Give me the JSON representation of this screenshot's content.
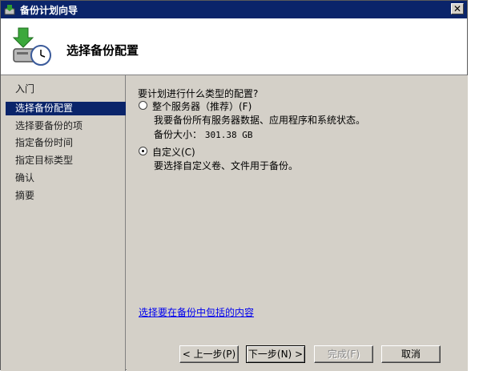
{
  "window": {
    "title": "备份计划向导"
  },
  "header": {
    "title": "选择备份配置"
  },
  "sidebar": {
    "items": [
      {
        "label": "入门",
        "active": false
      },
      {
        "label": "选择备份配置",
        "active": true
      },
      {
        "label": "选择要备份的项",
        "active": false
      },
      {
        "label": "指定备份时间",
        "active": false
      },
      {
        "label": "指定目标类型",
        "active": false
      },
      {
        "label": "确认",
        "active": false
      },
      {
        "label": "摘要",
        "active": false
      }
    ]
  },
  "main": {
    "question": "要计划进行什么类型的配置?",
    "options": [
      {
        "label": "整个服务器（推荐）(F)",
        "description": "我要备份所有服务器数据、应用程序和系统状态。",
        "size_label": "备份大小：",
        "size_value": "301.38 GB",
        "selected": false
      },
      {
        "label": "自定义(C)",
        "description": "要选择自定义卷、文件用于备份。",
        "selected": true
      }
    ],
    "link": "选择要在备份中包括的内容"
  },
  "buttons": {
    "back": "< 上一步(P)",
    "next": "下一步(N) >",
    "finish": "完成(F)",
    "cancel": "取消"
  },
  "colors": {
    "titlebar": "#0a246a",
    "selection": "#0a246a",
    "link": "#0000ee",
    "panel": "#d4d0c8"
  }
}
